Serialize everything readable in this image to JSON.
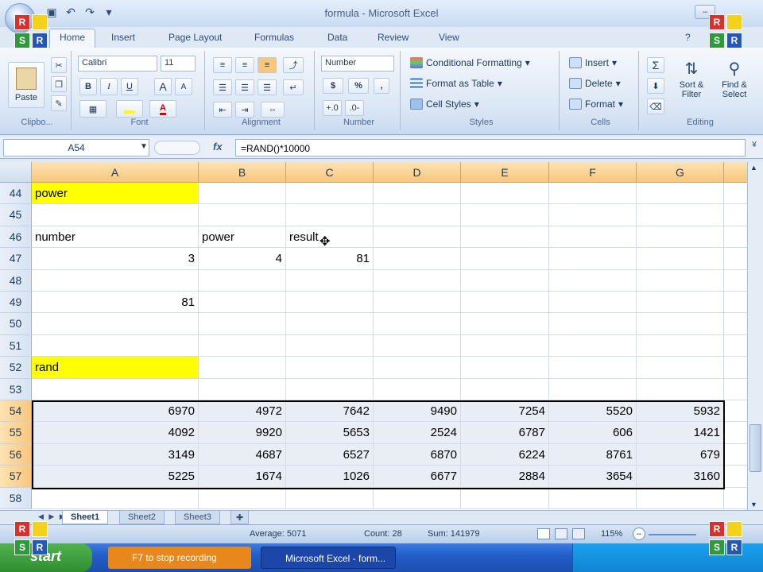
{
  "window": {
    "title": "formula - Microsoft Excel",
    "minimize": "–",
    "maximize": "□",
    "close": "✕"
  },
  "logo": {
    "letters": [
      "R",
      "",
      "S",
      "R"
    ]
  },
  "ribbon": {
    "tabs": [
      "Home",
      "Insert",
      "Page Layout",
      "Formulas",
      "Data",
      "Review",
      "View"
    ],
    "clipboard": {
      "paste": "Paste",
      "label": "Clipbo..."
    },
    "font": {
      "name": "Calibri",
      "size": "11",
      "bold": "B",
      "italic": "I",
      "underline": "U",
      "grow": "A",
      "shrink": "A",
      "label": "Font"
    },
    "alignment": {
      "label": "Alignment"
    },
    "number": {
      "format": "Number",
      "currency": "$",
      "percent": "%",
      "comma": ",",
      "label": "Number"
    },
    "styles": {
      "conditional": "Conditional Formatting",
      "table": "Format as Table",
      "cell": "Cell Styles",
      "label": "Styles"
    },
    "cells": {
      "insert": "Insert",
      "delete": "Delete",
      "format": "Format",
      "label": "Cells"
    },
    "editing": {
      "sum": "Σ",
      "sort": "Sort & Filter",
      "find": "Find & Select",
      "label": "Editing"
    }
  },
  "formula_bar": {
    "name_box": "A54",
    "fx": "fx",
    "formula": "=RAND()*10000"
  },
  "columns": [
    "A",
    "B",
    "C",
    "D",
    "E",
    "F",
    "G"
  ],
  "rows": [
    {
      "n": "44",
      "cells": [
        "power",
        "",
        "",
        "",
        "",
        "",
        ""
      ]
    },
    {
      "n": "45",
      "cells": [
        "",
        "",
        "",
        "",
        "",
        "",
        ""
      ]
    },
    {
      "n": "46",
      "cells": [
        "number",
        "power",
        "result",
        "",
        "",
        "",
        ""
      ]
    },
    {
      "n": "47",
      "cells": [
        "3",
        "4",
        "81",
        "",
        "",
        "",
        ""
      ]
    },
    {
      "n": "48",
      "cells": [
        "",
        "",
        "",
        "",
        "",
        "",
        ""
      ]
    },
    {
      "n": "49",
      "cells": [
        "81",
        "",
        "",
        "",
        "",
        "",
        ""
      ]
    },
    {
      "n": "50",
      "cells": [
        "",
        "",
        "",
        "",
        "",
        "",
        ""
      ]
    },
    {
      "n": "51",
      "cells": [
        "",
        "",
        "",
        "",
        "",
        "",
        ""
      ]
    },
    {
      "n": "52",
      "cells": [
        "rand",
        "",
        "",
        "",
        "",
        "",
        ""
      ]
    },
    {
      "n": "53",
      "cells": [
        "",
        "",
        "",
        "",
        "",
        "",
        ""
      ]
    },
    {
      "n": "54",
      "cells": [
        "6970",
        "4972",
        "7642",
        "9490",
        "7254",
        "5520",
        "5932"
      ]
    },
    {
      "n": "55",
      "cells": [
        "4092",
        "9920",
        "5653",
        "2524",
        "6787",
        "606",
        "1421"
      ]
    },
    {
      "n": "56",
      "cells": [
        "3149",
        "4687",
        "6527",
        "6870",
        "6224",
        "8761",
        "679"
      ]
    },
    {
      "n": "57",
      "cells": [
        "5225",
        "1674",
        "1026",
        "6677",
        "2884",
        "3654",
        "3160"
      ]
    },
    {
      "n": "58",
      "cells": [
        "",
        "",
        "",
        "",
        "",
        "",
        ""
      ]
    }
  ],
  "sheets": [
    "Sheet1",
    "Sheet2",
    "Sheet3"
  ],
  "status": {
    "average": "Average: 5071",
    "count": "Count: 28",
    "sum": "Sum: 141979",
    "zoom": "115%"
  },
  "taskbar": {
    "start": "start",
    "tasks": [
      "F7 to stop recording",
      "Microsoft Excel - form..."
    ]
  },
  "colors": {
    "highlight": "#ffff00",
    "header_selected": "#f8c77c",
    "taskbar": "#235ec8"
  }
}
